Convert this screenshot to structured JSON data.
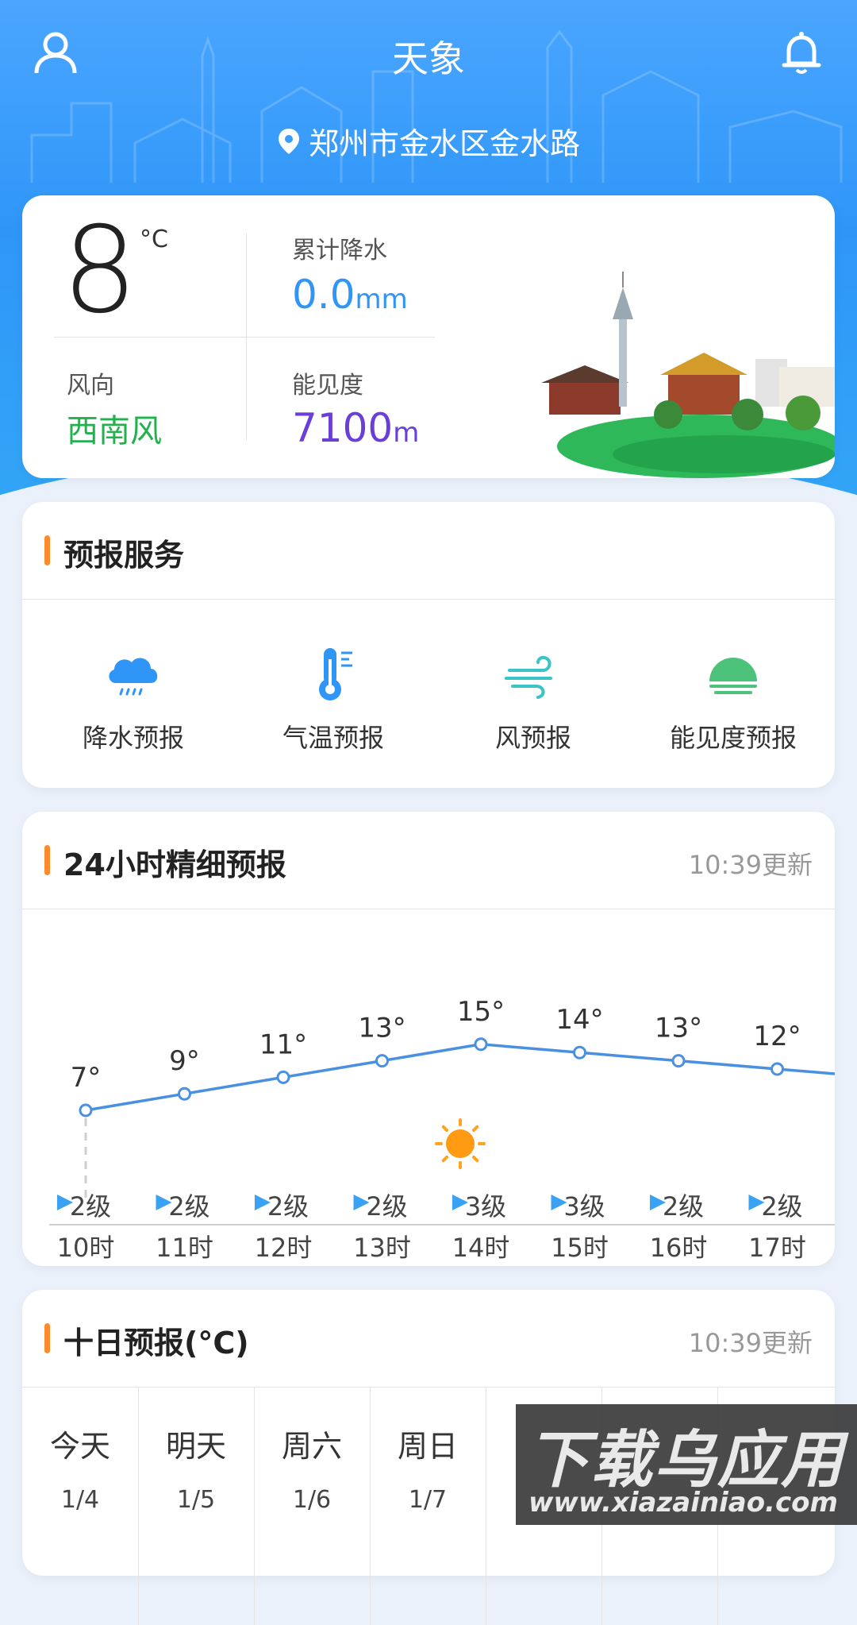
{
  "header": {
    "title": "天象",
    "location": "郑州市金水区金水路"
  },
  "current": {
    "temperature": "8",
    "temp_unit": "°C",
    "precip_label": "累计降水",
    "precip_value": "0.0",
    "precip_unit": "mm",
    "wind_label": "风向",
    "wind_value": "西南风",
    "visibility_label": "能见度",
    "visibility_value": "7100",
    "visibility_unit": "m"
  },
  "services": {
    "title": "预报服务",
    "items": [
      {
        "label": "降水预报",
        "icon": "rain-cloud-icon"
      },
      {
        "label": "气温预报",
        "icon": "thermometer-icon"
      },
      {
        "label": "风预报",
        "icon": "wind-icon"
      },
      {
        "label": "能见度预报",
        "icon": "visibility-icon"
      }
    ]
  },
  "hourly": {
    "title": "24小时精细预报",
    "updated": "10:39更新",
    "hours": [
      "10时",
      "11时",
      "12时",
      "13时",
      "14时",
      "15时",
      "16时",
      "17时"
    ],
    "temps": [
      "7°",
      "9°",
      "11°",
      "13°",
      "15°",
      "14°",
      "13°",
      "12°"
    ],
    "temp_values": [
      7,
      9,
      11,
      13,
      15,
      14,
      13,
      12
    ],
    "winds": [
      "2级",
      "2级",
      "2级",
      "2级",
      "3级",
      "3级",
      "2级",
      "2级"
    ],
    "weather_icon": "sun-icon"
  },
  "daily": {
    "title": "十日预报(°C)",
    "updated": "10:39更新",
    "days": [
      {
        "name": "今天",
        "date": "1/4"
      },
      {
        "name": "明天",
        "date": "1/5"
      },
      {
        "name": "周六",
        "date": "1/6"
      },
      {
        "name": "周日",
        "date": "1/7"
      }
    ]
  },
  "watermark": {
    "text": "下载乌应用",
    "url": "www.xiazainiao.com"
  },
  "colors": {
    "accent_bar": "#ff8a2b",
    "precip": "#2f96f8",
    "wind": "#22b14c",
    "visibility": "#6a3fd8",
    "line": "#4a90e2"
  }
}
